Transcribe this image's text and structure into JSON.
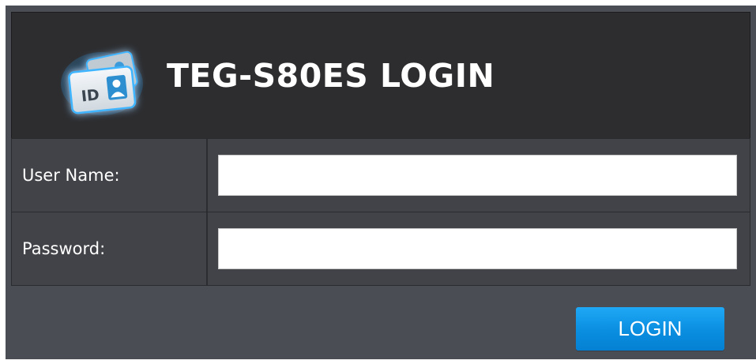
{
  "header": {
    "title": "TEG-S80ES LOGIN",
    "icon": "id-card-icon",
    "icon_text": "ID"
  },
  "form": {
    "username_label": "User Name:",
    "username_value": "",
    "password_label": "Password:",
    "password_value": ""
  },
  "actions": {
    "login_label": "LOGIN"
  },
  "colors": {
    "panel_bg": "#4b4d55",
    "header_bg": "#2d2d2f",
    "row_bg": "#424348",
    "button_accent": "#0a8ee0",
    "icon_glow": "#3fb5ff"
  }
}
